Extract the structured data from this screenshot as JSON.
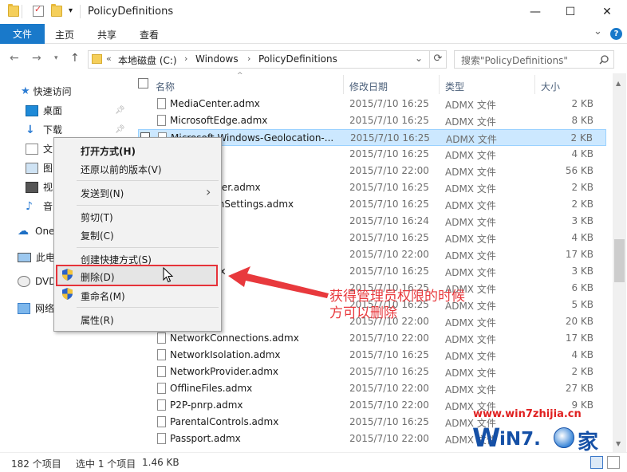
{
  "window": {
    "title": "PolicyDefinitions",
    "min": "—",
    "max": "☐",
    "close": "✕",
    "quick_access_dropdown": "▾"
  },
  "ribbon": {
    "file": "文件",
    "home": "主页",
    "share": "共享",
    "view": "查看",
    "collapse": "⌄",
    "help": "?"
  },
  "address": {
    "chevron": "«",
    "crumbs": [
      "本地磁盘 (C:)",
      "Windows",
      "PolicyDefinitions"
    ],
    "sep": "›",
    "dropdown": "⌄",
    "refresh": "⟳"
  },
  "search": {
    "placeholder": "搜索\"PolicyDefinitions\""
  },
  "nav": {
    "quick_access": "快速访问",
    "desktop": "桌面",
    "downloads": "下载",
    "documents": "文",
    "pictures": "图",
    "videos": "视",
    "music": "音",
    "onedrive": "One",
    "thispc": "此电",
    "dvd": "DVD",
    "network": "网络"
  },
  "columns": {
    "name": "名称",
    "date": "修改日期",
    "type": "类型",
    "size": "大小"
  },
  "files": [
    {
      "name": "MediaCenter.admx",
      "date": "2015/7/10 16:25",
      "type": "ADMX 文件",
      "size": "2 KB"
    },
    {
      "name": "MicrosoftEdge.admx",
      "date": "2015/7/10 16:25",
      "type": "ADMX 文件",
      "size": "8 KB"
    },
    {
      "name": "Microsoft-Windows-Geolocation-...",
      "date": "2015/7/10 16:25",
      "type": "ADMX 文件",
      "size": "2 KB"
    },
    {
      "name": "",
      "date": "2015/7/10 16:25",
      "type": "ADMX 文件",
      "size": "4 KB"
    },
    {
      "name": "ns.admx",
      "date": "2015/7/10 22:00",
      "type": "ADMX 文件",
      "size": "56 KB"
    },
    {
      "name": "obilityCenter.admx",
      "date": "2015/7/10 16:25",
      "type": "ADMX 文件",
      "size": "2 KB"
    },
    {
      "name": "resentationSettings.admx",
      "date": "2015/7/10 16:25",
      "type": "ADMX 文件",
      "size": "2 KB"
    },
    {
      "name": "mx",
      "date": "2015/7/10 16:24",
      "type": "ADMX 文件",
      "size": "3 KB"
    },
    {
      "name": "x",
      "date": "2015/7/10 16:25",
      "type": "ADMX 文件",
      "size": "4 KB"
    },
    {
      "name": "",
      "date": "2015/7/10 22:00",
      "type": "ADMX 文件",
      "size": "17 KB"
    },
    {
      "name": "overy.admx",
      "date": "2015/7/10 16:25",
      "type": "ADMX 文件",
      "size": "3 KB"
    },
    {
      "name": "",
      "date": "2015/7/10 16:25",
      "type": "ADMX 文件",
      "size": "6 KB"
    },
    {
      "name": "",
      "date": "2015/7/10 16:25",
      "type": "ADMX 文件",
      "size": "5 KB"
    },
    {
      "name": "dmx",
      "date": "2015/7/10 22:00",
      "type": "ADMX 文件",
      "size": "20 KB"
    },
    {
      "name": "NetworkConnections.admx",
      "date": "2015/7/10 22:00",
      "type": "ADMX 文件",
      "size": "17 KB"
    },
    {
      "name": "NetworkIsolation.admx",
      "date": "2015/7/10 16:25",
      "type": "ADMX 文件",
      "size": "4 KB"
    },
    {
      "name": "NetworkProvider.admx",
      "date": "2015/7/10 16:25",
      "type": "ADMX 文件",
      "size": "2 KB"
    },
    {
      "name": "OfflineFiles.admx",
      "date": "2015/7/10 22:00",
      "type": "ADMX 文件",
      "size": "27 KB"
    },
    {
      "name": "P2P-pnrp.admx",
      "date": "2015/7/10 22:00",
      "type": "ADMX 文件",
      "size": "9 KB"
    },
    {
      "name": "ParentalControls.admx",
      "date": "2015/7/10 16:25",
      "type": "ADMX 文件",
      "size": ""
    },
    {
      "name": "Passport.admx",
      "date": "2015/7/10 22:00",
      "type": "ADMX 文件",
      "size": ""
    }
  ],
  "context_menu": {
    "open_with": "打开方式(H)",
    "restore": "还原以前的版本(V)",
    "send_to": "发送到(N)",
    "send_to_arrow": "›",
    "cut": "剪切(T)",
    "copy": "复制(C)",
    "shortcut": "创建快捷方式(S)",
    "delete": "删除(D)",
    "rename": "重命名(M)",
    "properties": "属性(R)"
  },
  "annotation": {
    "line1": "获得管理员权限的时候",
    "line2": "方可以删除"
  },
  "status": {
    "count": "182 个项目",
    "selected": "选中 1 个项目",
    "size": "1.46 KB"
  },
  "watermark": {
    "url": "www.win7zhijia.cn",
    "logo_left": "W",
    "logo_mid": "iN7.",
    "logo_right": "家"
  },
  "colors": {
    "accent": "#1979ca",
    "selection": "#cce8ff",
    "annotation": "#e8393d"
  }
}
